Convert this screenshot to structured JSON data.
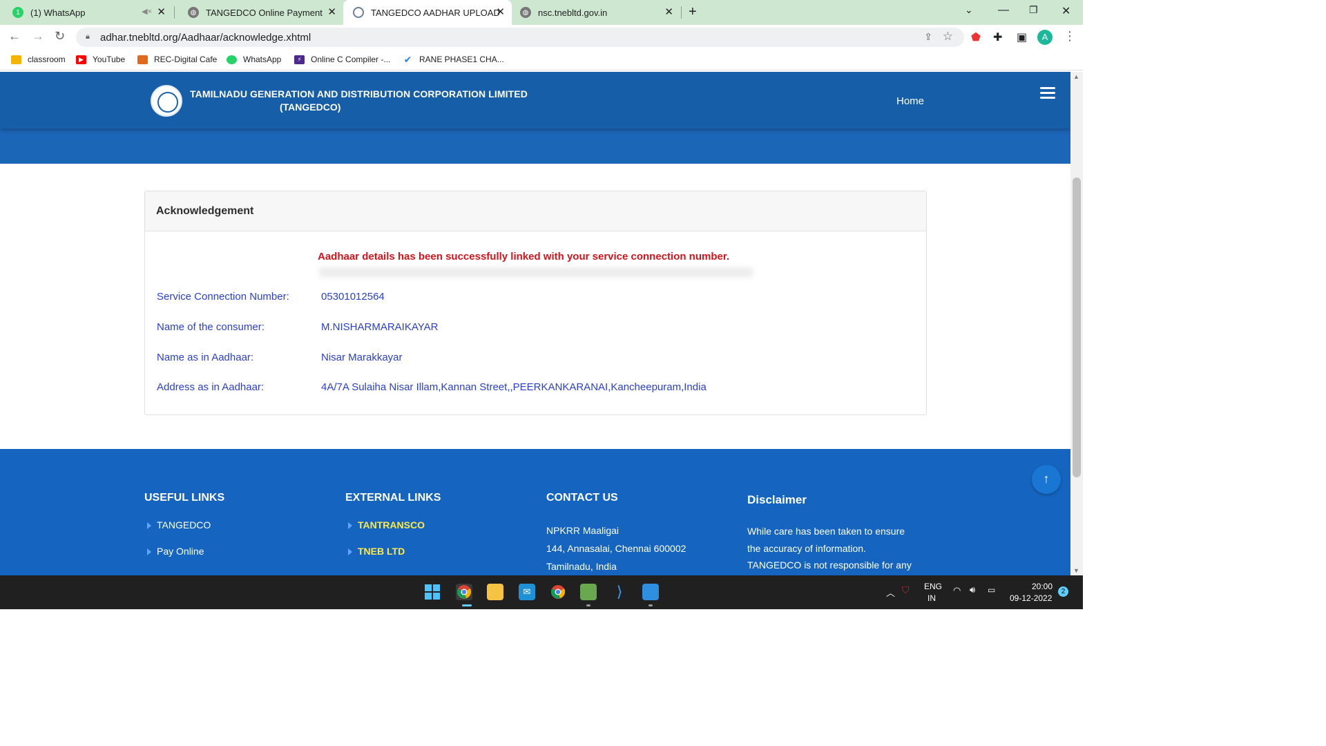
{
  "browser": {
    "tabs": [
      {
        "title": "(1) WhatsApp",
        "favicon": "whatsapp-icon",
        "badge": "1",
        "active": false
      },
      {
        "title": "TANGEDCO Online Payment",
        "favicon": "globe-icon",
        "active": false
      },
      {
        "title": "TANGEDCO AADHAR UPLOAD",
        "favicon": "tangedco-logo-icon",
        "active": true
      },
      {
        "title": "nsc.tnebltd.gov.in",
        "favicon": "globe-icon",
        "active": false
      }
    ],
    "url": "adhar.tnebltd.org/Aadhaar/acknowledge.xhtml",
    "profile_initial": "A",
    "bookmarks": [
      {
        "label": "classroom",
        "icon": "classroom-icon",
        "color": "#f6b400"
      },
      {
        "label": "YouTube",
        "icon": "youtube-icon",
        "color": "#ff0000"
      },
      {
        "label": "REC-Digital Cafe",
        "icon": "rec-icon",
        "color": "#e06a1b"
      },
      {
        "label": "WhatsApp",
        "icon": "whatsapp-icon",
        "color": "#25d366"
      },
      {
        "label": "Online C Compiler -...",
        "icon": "compiler-icon",
        "color": "#4a2a8c"
      },
      {
        "label": "RANE PHASE1 CHA...",
        "icon": "checkmark-icon",
        "color": "#1e88e5"
      }
    ]
  },
  "site": {
    "org_line1": "TAMILNADU GENERATION AND DISTRIBUTION CORPORATION LIMITED",
    "org_line2": "(TANGEDCO)",
    "nav_home": "Home",
    "brand_color": "#165ea8"
  },
  "ack": {
    "heading": "Acknowledgement",
    "message": "Aadhaar details has been successfully linked with your service connection number.",
    "rows": [
      {
        "label": "Service Connection Number:",
        "value": "05301012564"
      },
      {
        "label": "Name of the consumer:",
        "value": "M.NISHARMARAIKAYAR"
      },
      {
        "label": "Name as in Aadhaar:",
        "value": "Nisar Marakkayar"
      },
      {
        "label": "Address as in Aadhaar:",
        "value": "4A/7A Sulaiha Nisar Illam,Kannan Street,,PEERKANKARANAI,Kancheepuram,India"
      }
    ]
  },
  "footer": {
    "useful_heading": "USEFUL LINKS",
    "useful_links": [
      "TANGEDCO",
      "Pay Online"
    ],
    "external_heading": "EXTERNAL LINKS",
    "external_links": [
      "TANTRANSCO",
      "TNEB LTD"
    ],
    "contact_heading": "CONTACT US",
    "contact_lines": [
      "NPKRR Maaligai",
      "144, Annasalai, Chennai 600002",
      "Tamilnadu, India"
    ],
    "disclaimer_heading": "Disclaimer",
    "disclaimer_lines": [
      "While care has been taken to ensure",
      "the accuracy of information.",
      "TANGEDCO is not responsible for any"
    ]
  },
  "taskbar": {
    "lang": "ENG",
    "region": "IN",
    "time": "20:00",
    "date": "09-12-2022",
    "notifications": "2"
  }
}
